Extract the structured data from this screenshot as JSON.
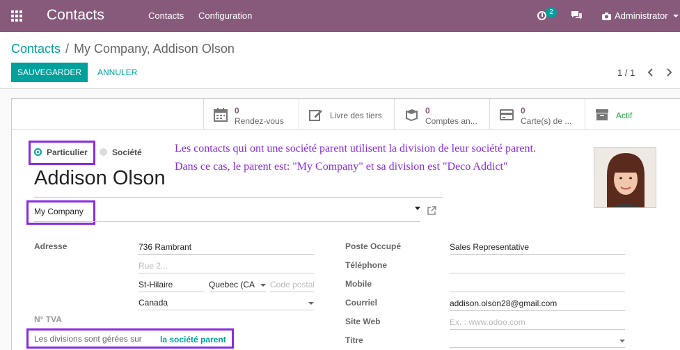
{
  "navbar": {
    "brand": "Contacts",
    "menu": [
      "Contacts",
      "Configuration"
    ],
    "activity_count": "2",
    "user": "Administrator",
    "color": "#875a7b"
  },
  "breadcrumb": {
    "parent": "Contacts",
    "separator": "/",
    "current": "My Company, Addison Olson"
  },
  "actions": {
    "save": "SAUVEGARDER",
    "cancel": "ANNULER"
  },
  "pager": {
    "value": "1 / 1"
  },
  "smart_buttons": [
    {
      "count": "0",
      "label": "Rendez-vous",
      "icon": "calendar-icon"
    },
    {
      "count": "",
      "label": "Livre des tiers",
      "icon": "edit-icon"
    },
    {
      "count": "0",
      "label": "Comptes an...",
      "icon": "book-icon"
    },
    {
      "count": "0",
      "label": "Carte(s) de ...",
      "icon": "credit-card-icon"
    },
    {
      "count": "",
      "label": "Actif",
      "icon": "archive-icon"
    }
  ],
  "company_type": {
    "options": [
      "Particulier",
      "Société"
    ],
    "selected": "Particulier"
  },
  "annotation": {
    "line1": "Les contacts qui ont une société parent utilisent la division de leur société parent.",
    "line2": "Dans ce cas, le parent est: \"My Company\" et sa division est \"Deco Addict\""
  },
  "partner": {
    "name": "Addison Olson",
    "parent_company": "My Company"
  },
  "address": {
    "label": "Adresse",
    "street": "736 Rambrant",
    "street2_placeholder": "Rue 2...",
    "city": "St-Hilaire",
    "state": "Quebec (CA",
    "zip_placeholder": "Code postal",
    "country": "Canada"
  },
  "vat": {
    "label": "N° TVA"
  },
  "divisions": {
    "label": "Les divisions sont gérées sur",
    "link": "la société parent"
  },
  "right_fields": {
    "function_label": "Poste Occupé",
    "function_value": "Sales Representative",
    "phone_label": "Téléphone",
    "mobile_label": "Mobile",
    "email_label": "Courriel",
    "email_value": "addison.olson28@gmail.com",
    "website_label": "Site Web",
    "website_placeholder": "Ex. : www.odoo.com",
    "title_label": "Titre"
  },
  "colors": {
    "primary": "#00a09d",
    "highlight": "#8a2be2",
    "active_green": "#28a745"
  }
}
